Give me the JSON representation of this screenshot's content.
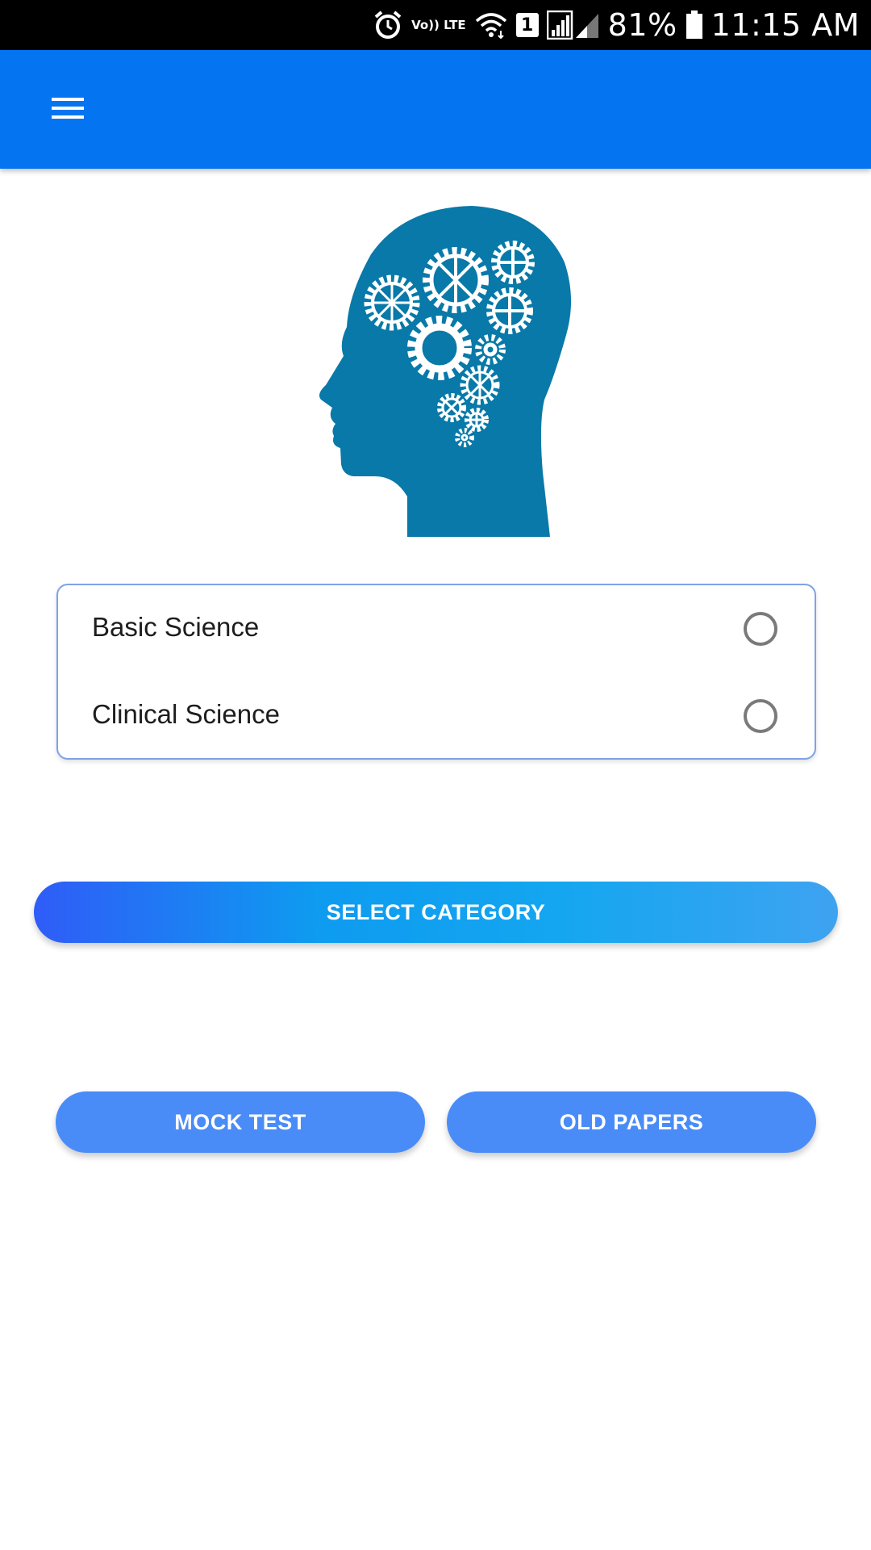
{
  "status_bar": {
    "network_label": "Vo)) LTE",
    "sim_slot": "1",
    "battery_percent": "81%",
    "time": "11:15 AM",
    "icons": [
      "alarm-icon",
      "volte-icon",
      "wifi-icon",
      "sim-icon",
      "signal-icon",
      "battery-icon"
    ]
  },
  "app_bar": {
    "color": "#0474f0",
    "menu_icon": "hamburger-menu-icon"
  },
  "illustration": {
    "name": "head-with-gears",
    "color": "#0879a8"
  },
  "category_options": {
    "items": [
      {
        "label": "Basic Science",
        "selected": false
      },
      {
        "label": "Clinical Science",
        "selected": false
      }
    ]
  },
  "buttons": {
    "select_category": "SELECT CATEGORY",
    "mock_test": "MOCK TEST",
    "old_papers": "OLD PAPERS"
  }
}
